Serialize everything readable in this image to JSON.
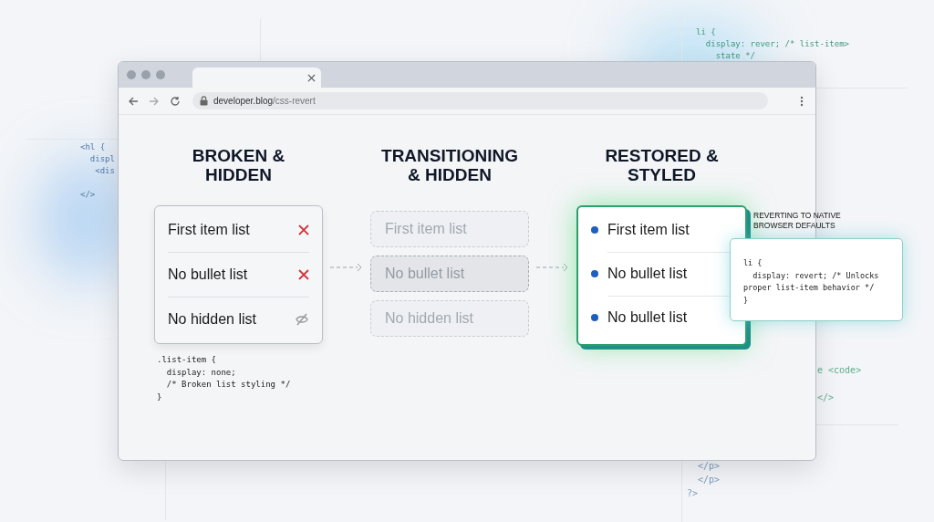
{
  "background_code": [
    {
      "lines": [
        "li {",
        "  display: rever; /* list-item>",
        "    state */"
      ]
    },
    {
      "lines": [
        "<hl {",
        "  displ",
        "   <dis",
        "</>"
      ]
    },
    {
      "lines": [
        "e <code>",
        "</>"
      ]
    },
    {
      "lines": [
        "  </p>",
        "  </p>",
        "?>"
      ]
    }
  ],
  "browser": {
    "url_host": "developer.blog",
    "url_path": "/css-revert"
  },
  "columns": [
    {
      "kind": "broken",
      "title": "BROKEN &\nHIDDEN",
      "items": [
        {
          "label": "First item list",
          "kind": "cross"
        },
        {
          "label": "No bullet list",
          "kind": "cross"
        },
        {
          "label": "No hidden list",
          "kind": "hidden"
        }
      ],
      "code": [
        ".list-item {",
        "  display: none;",
        "  /* Broken list styling */",
        "}"
      ]
    },
    {
      "kind": "transitioning",
      "title": "TRANSITIONING\n& HIDDEN",
      "items": [
        {
          "label": "First item list"
        },
        {
          "label": "No bullet list"
        },
        {
          "label": "No hidden list"
        }
      ]
    },
    {
      "kind": "restored",
      "title": "RESTORED &\nSTYLED",
      "items": [
        {
          "label": "First item list",
          "kind": "bullet"
        },
        {
          "label": "No bullet list",
          "kind": "bullet"
        },
        {
          "label": "No bullet list",
          "kind": "bullet"
        }
      ]
    }
  ],
  "callout": {
    "label": "REVERTING TO NATIVE\nBROWSER DEFAULTS",
    "code": [
      "li {",
      "  display: revert; /* Unlocks",
      "proper list-item behavior */",
      "}"
    ]
  }
}
